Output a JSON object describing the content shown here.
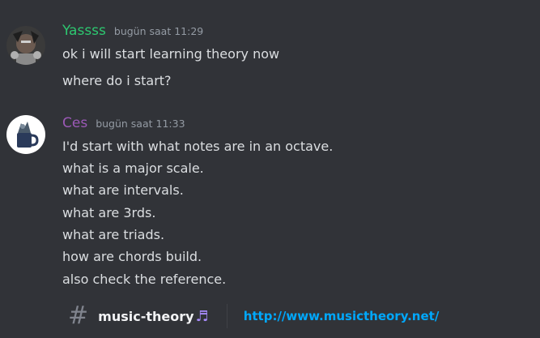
{
  "messages": [
    {
      "username": "Yassss",
      "username_color": "#2dc770",
      "timestamp": "bugün saat 11:29",
      "lines": [
        "ok i will start learning theory now",
        "where do i start?"
      ]
    },
    {
      "username": "Ces",
      "username_color": "#9b59b6",
      "timestamp": "bugün saat 11:33",
      "lines": [
        "I'd start with what notes are in an octave.",
        "what is a major scale.",
        "what are intervals.",
        "what are 3rds.",
        "what are triads.",
        "how are chords build.",
        "also check the reference."
      ]
    }
  ],
  "embed": {
    "channel_icon": "hash-icon",
    "channel_name": "music-theory",
    "channel_emoji": "♬",
    "link": "http://www.musictheory.net/"
  }
}
